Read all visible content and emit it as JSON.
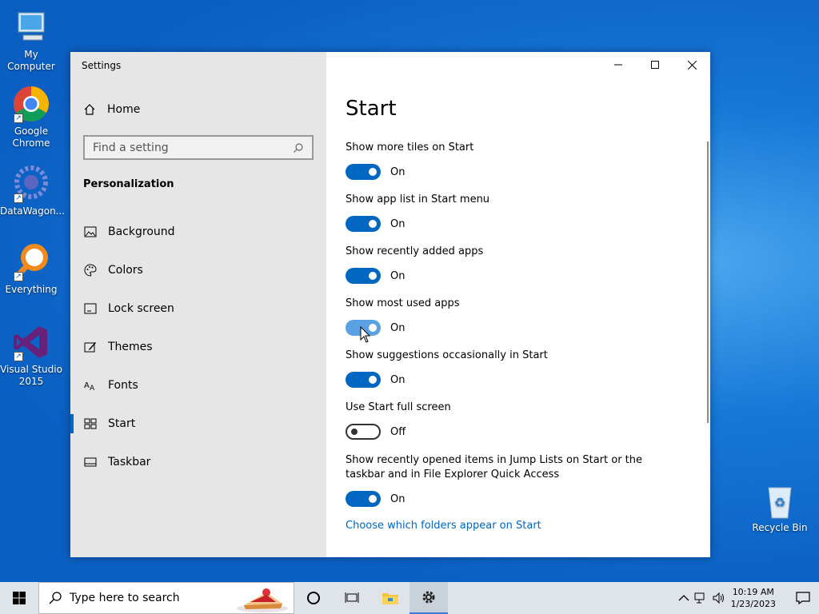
{
  "desktop": {
    "icons": [
      {
        "label": "My Computer"
      },
      {
        "label": "Google Chrome"
      },
      {
        "label": "DataWagon..."
      },
      {
        "label": "Everything"
      },
      {
        "label": "Visual Studio 2015"
      },
      {
        "label": "Recycle Bin"
      }
    ]
  },
  "window": {
    "title": "Settings",
    "sidebar": {
      "home_label": "Home",
      "search_placeholder": "Find a setting",
      "section": "Personalization",
      "items": [
        {
          "label": "Background"
        },
        {
          "label": "Colors"
        },
        {
          "label": "Lock screen"
        },
        {
          "label": "Themes"
        },
        {
          "label": "Fonts"
        },
        {
          "label": "Start"
        },
        {
          "label": "Taskbar"
        }
      ]
    },
    "main": {
      "title": "Start",
      "settings": [
        {
          "label": "Show more tiles on Start",
          "state": "On"
        },
        {
          "label": "Show app list in Start menu",
          "state": "On"
        },
        {
          "label": "Show recently added apps",
          "state": "On"
        },
        {
          "label": "Show most used apps",
          "state": "On"
        },
        {
          "label": "Show suggestions occasionally in Start",
          "state": "On"
        },
        {
          "label": "Use Start full screen",
          "state": "Off"
        },
        {
          "label": "Show recently opened items in Jump Lists on Start or the taskbar and in File Explorer Quick Access",
          "state": "On"
        }
      ],
      "link": "Choose which folders appear on Start"
    }
  },
  "taskbar": {
    "search_placeholder": "Type here to search",
    "time": "10:19 AM",
    "date": "1/23/2023"
  },
  "colors": {
    "accent": "#0067c0",
    "sidebar_bg": "#e6e6e6"
  }
}
